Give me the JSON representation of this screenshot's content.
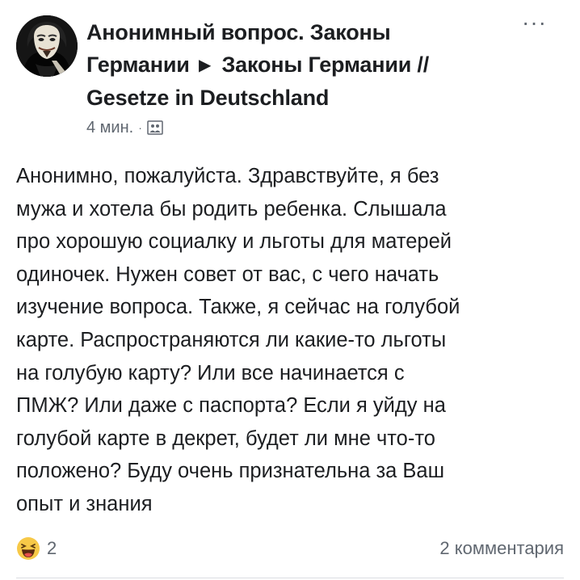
{
  "post": {
    "author_line1": "Анонимный вопрос. Законы",
    "author_line2": "Германии",
    "group_line2": "Законы Германии //",
    "group_line3": "Gesetze in Deutschland",
    "arrow": "▶",
    "more": "···",
    "time": "4 мин.",
    "separator": "·",
    "privacy_icon": "group-privacy-icon",
    "body_lines": [
      "Анонимно, пожалуйста. Здравствуйте, я без",
      "мужа и хотела бы родить ребенка. Слышала",
      "про хорошую социалку и льготы для матерей",
      "одиночек. Нужен совет от вас, с чего начать",
      "изучение вопроса. Также, я сейчас на голубой",
      "карте. Распространяются ли какие-то льготы",
      "на голубую карту? Или все начинается с",
      "ПМЖ? Или даже с паспорта? Если я уйду на",
      "голубой карте в декрет, будет ли мне что-то",
      "положено? Буду очень признательна за Ваш",
      "опыт и знания"
    ],
    "reaction_icon": "haha-reaction-icon",
    "reaction_count": "2",
    "comments": "2 комментария"
  },
  "colors": {
    "text": "#1c1e21",
    "secondary": "#606770",
    "reaction_yellow": "#f7c948"
  }
}
